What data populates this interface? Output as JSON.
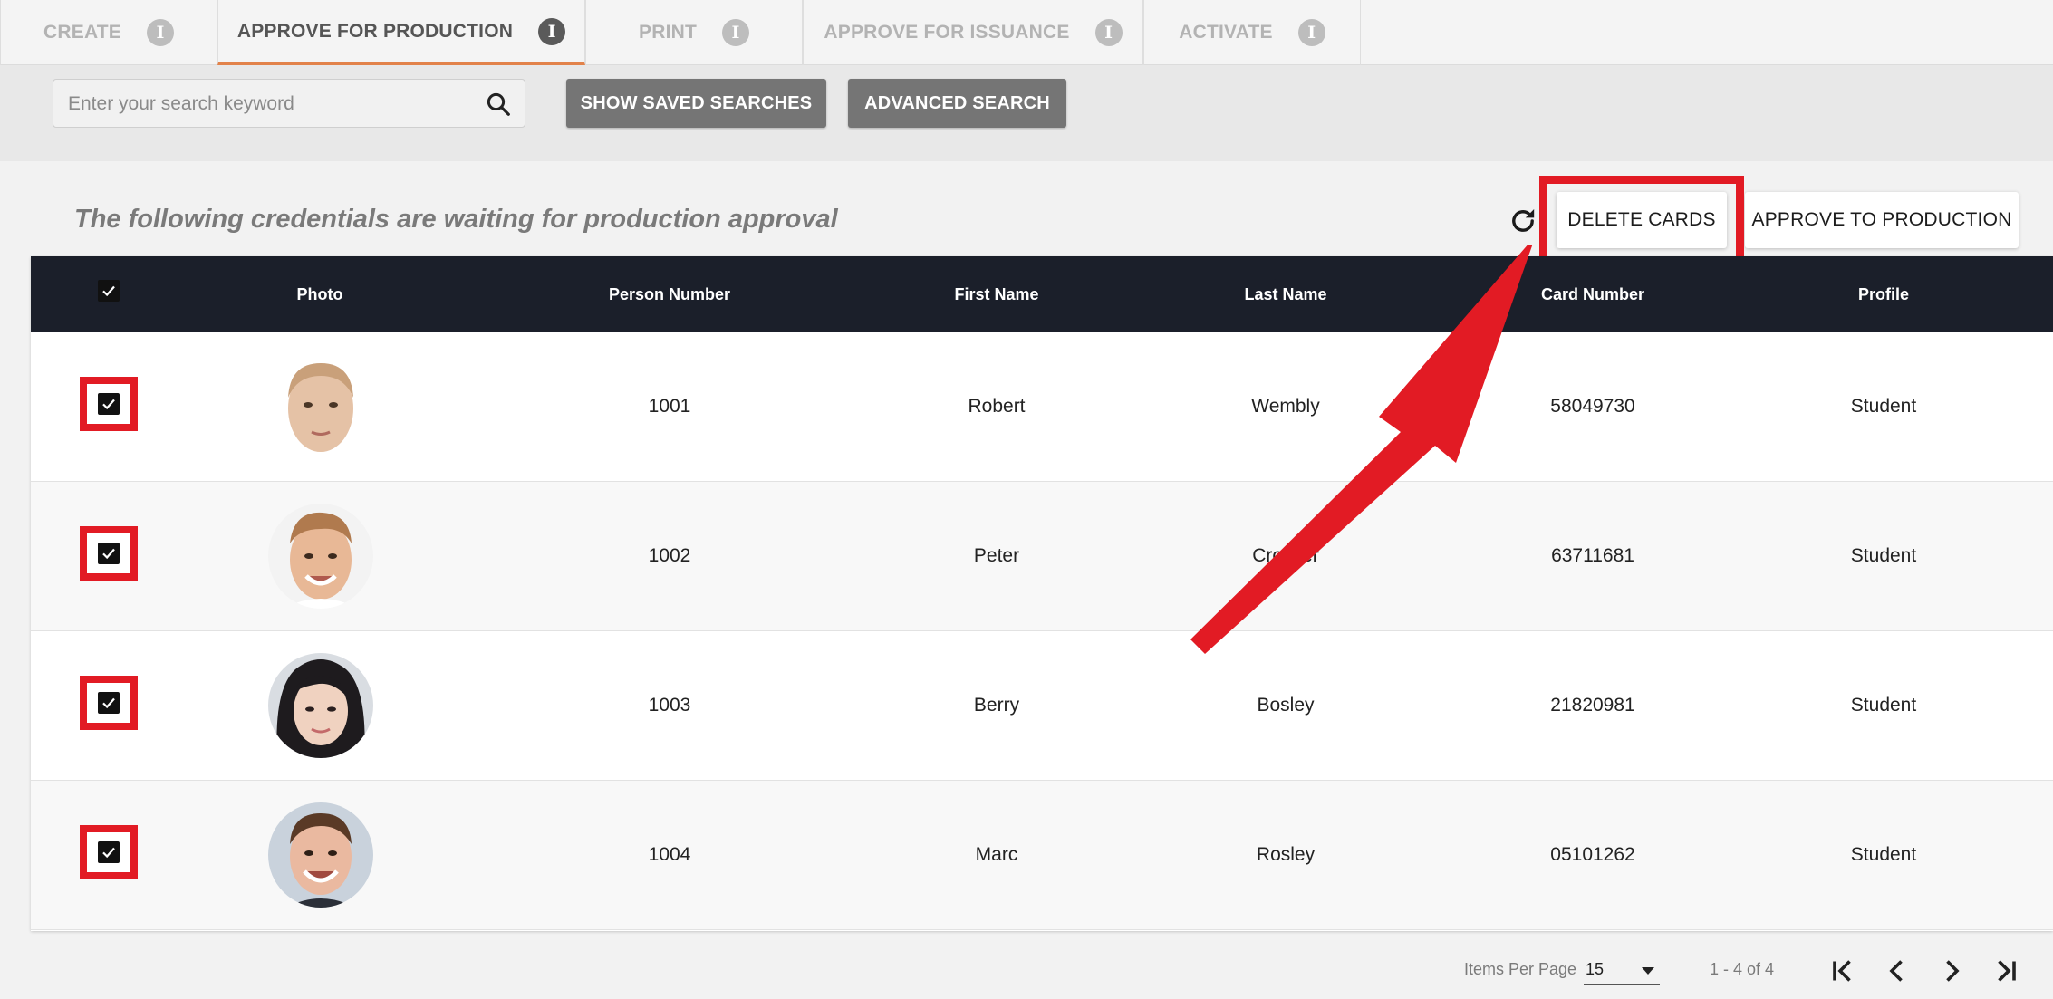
{
  "tabs": [
    {
      "label": "CREATE",
      "active": false
    },
    {
      "label": "APPROVE FOR PRODUCTION",
      "active": true
    },
    {
      "label": "PRINT",
      "active": false
    },
    {
      "label": "APPROVE FOR ISSUANCE",
      "active": false
    },
    {
      "label": "ACTIVATE",
      "active": false
    }
  ],
  "search": {
    "placeholder": "Enter your search keyword",
    "value": "",
    "show_saved_label": "SHOW SAVED SEARCHES",
    "advanced_label": "ADVANCED SEARCH"
  },
  "section": {
    "title": "The following credentials are waiting for production approval",
    "delete_label": "DELETE CARDS",
    "approve_label": "APPROVE TO PRODUCTION"
  },
  "table": {
    "columns": [
      "Photo",
      "Person Number",
      "First Name",
      "Last Name",
      "Card Number",
      "Profile"
    ],
    "rows": [
      {
        "person_number": "1001",
        "first_name": "Robert",
        "last_name": "Wembly",
        "card_number": "58049730",
        "profile": "Student",
        "checked": true
      },
      {
        "person_number": "1002",
        "first_name": "Peter",
        "last_name": "Crocker",
        "card_number": "63711681",
        "profile": "Student",
        "checked": true
      },
      {
        "person_number": "1003",
        "first_name": "Berry",
        "last_name": "Bosley",
        "card_number": "21820981",
        "profile": "Student",
        "checked": true
      },
      {
        "person_number": "1004",
        "first_name": "Marc",
        "last_name": "Rosley",
        "card_number": "05101262",
        "profile": "Student",
        "checked": true
      }
    ]
  },
  "pagination": {
    "items_per_page_label": "Items Per Page",
    "items_per_page": "15",
    "range": "1 - 4 of 4"
  },
  "colors": {
    "accent": "#e2824a",
    "header_bg": "#1b1f2a",
    "highlight": "#e21b24",
    "grey_button": "#757575"
  },
  "icons": [
    "info-icon",
    "search-icon",
    "refresh-icon",
    "check-icon",
    "first-page-icon",
    "prev-page-icon",
    "next-page-icon",
    "last-page-icon"
  ]
}
